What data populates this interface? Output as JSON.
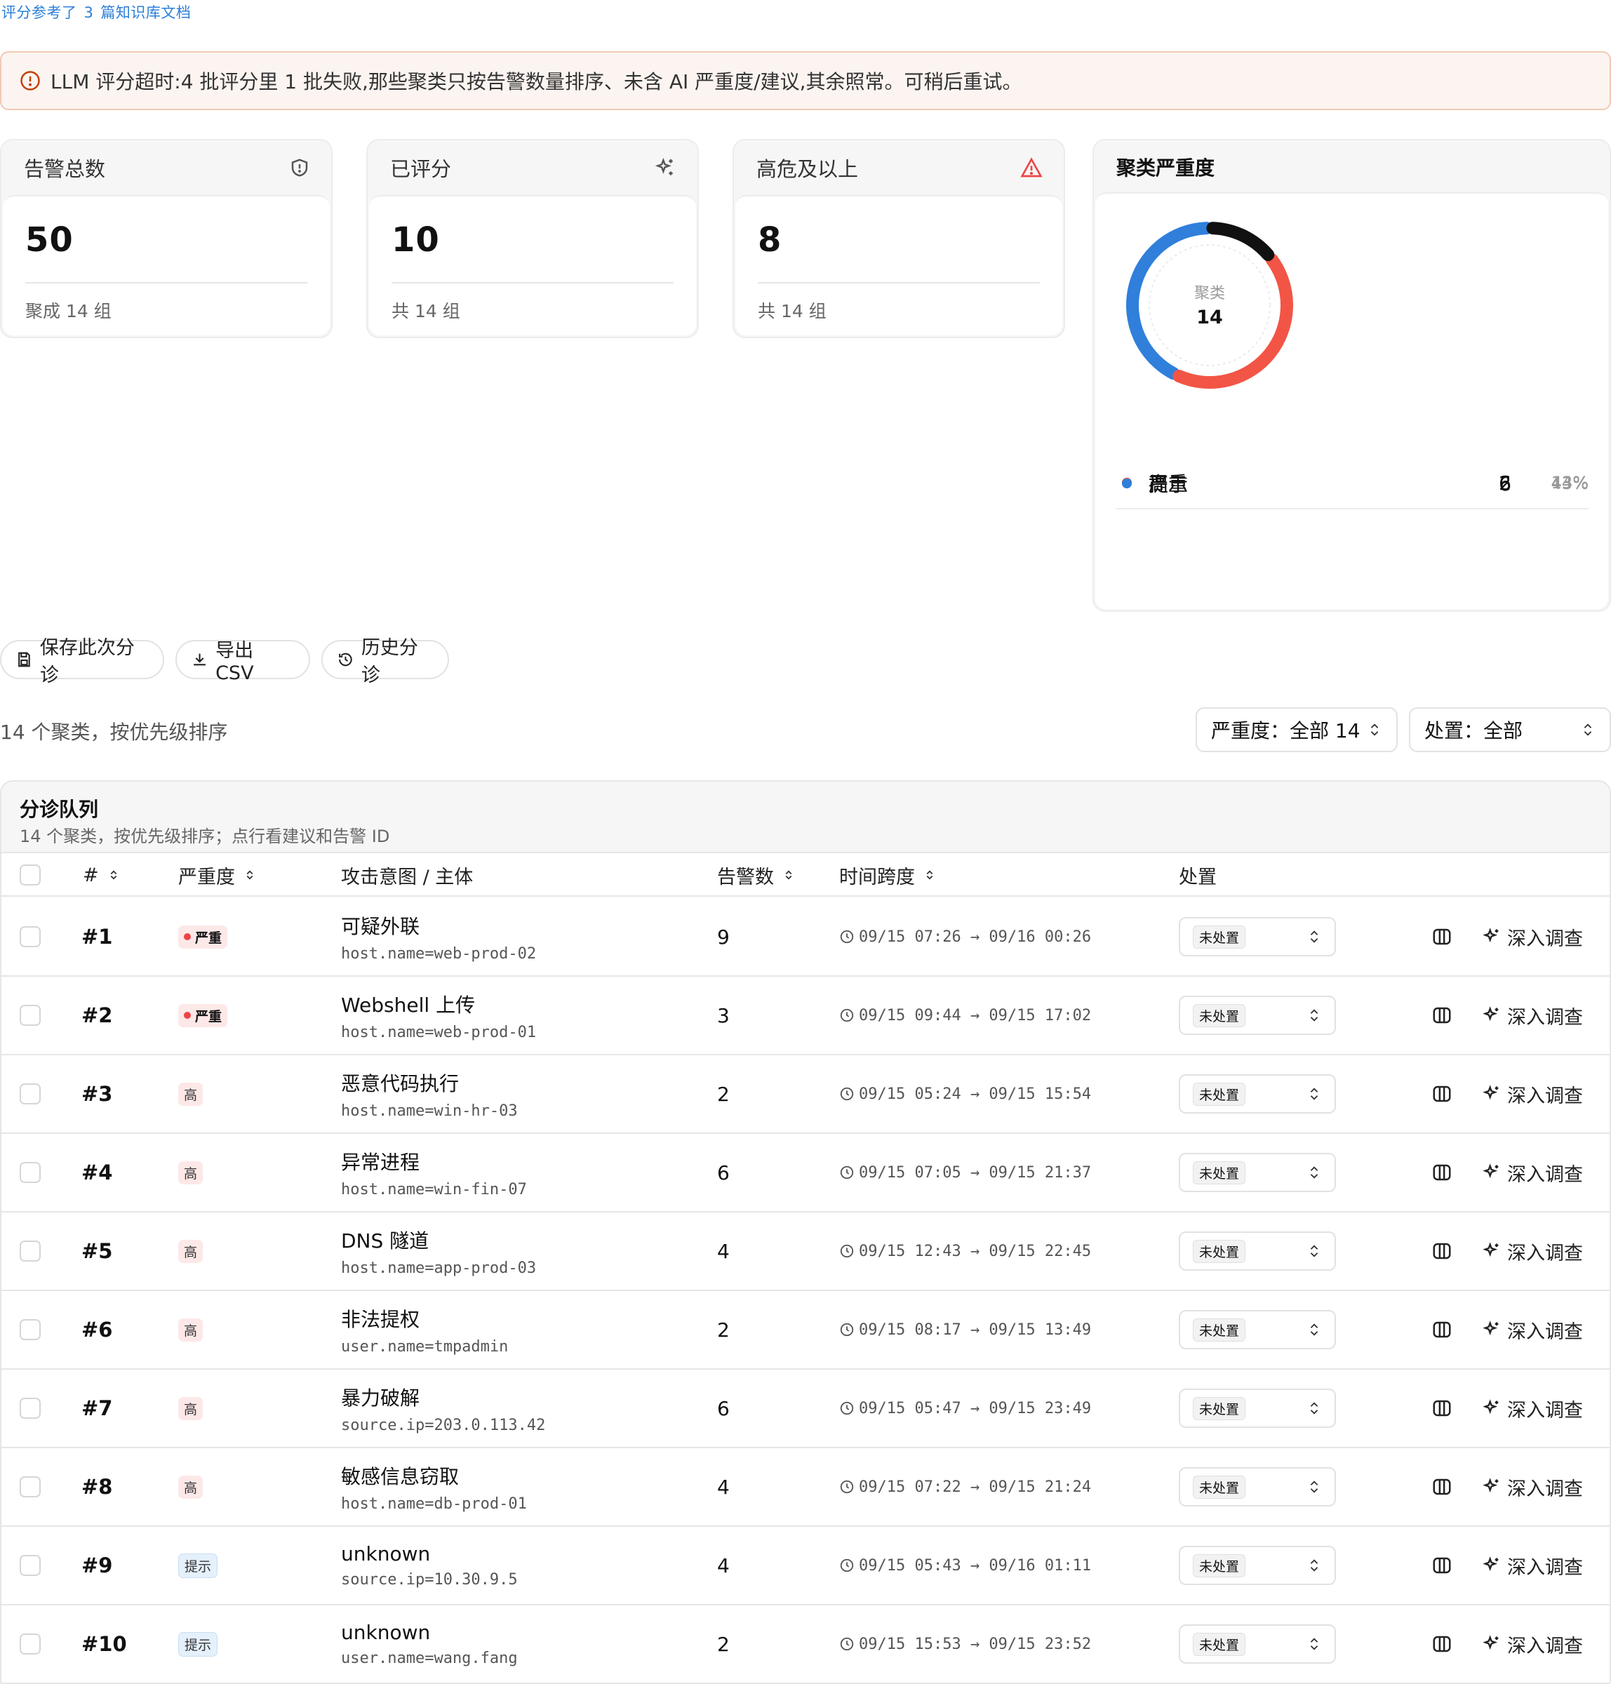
{
  "reference": {
    "prefix": "评分参考了",
    "count": "3",
    "suffix": "篇知识库文档"
  },
  "alert": {
    "text": "LLM 评分超时:4 批评分里 1 批失败,那些聚类只按告警数量排序、未含 AI 严重度/建议,其余照常。可稍后重试。"
  },
  "stats": [
    {
      "label": "告警总数",
      "value": "50",
      "sub": "聚成 14 组",
      "icon": "shield-icon"
    },
    {
      "label": "已评分",
      "value": "10",
      "sub": "共 14 组",
      "icon": "sparkles-icon"
    },
    {
      "label": "高危及以上",
      "value": "8",
      "sub": "共 14 组",
      "icon": "warning-icon"
    }
  ],
  "severity_card": {
    "title": "聚类严重度",
    "center_label": "聚类",
    "center_value": "14",
    "legend": [
      {
        "name": "严重",
        "count": "2",
        "pct": "14%",
        "color": "#111111"
      },
      {
        "name": "高",
        "count": "6",
        "pct": "43%",
        "color": "#f25545"
      },
      {
        "name": "提示",
        "count": "6",
        "pct": "43%",
        "color": "#2f7fdb"
      }
    ]
  },
  "chart_data": {
    "type": "pie",
    "categories": [
      "严重",
      "高",
      "提示"
    ],
    "values": [
      2,
      6,
      6
    ],
    "title": "聚类严重度",
    "center_text": "聚类 14"
  },
  "actions": {
    "save": "保存此次分诊",
    "export": "导出 CSV",
    "history": "历史分诊"
  },
  "summary": "14 个聚类，按优先级排序",
  "filters": {
    "severity": "严重度：全部 14",
    "disposition": "处置：全部"
  },
  "queue": {
    "title": "分诊队列",
    "subtitle": "14 个聚类，按优先级排序；点行看建议和告警 ID",
    "columns": {
      "rank": "#",
      "severity": "严重度",
      "intent": "攻击意图 / 主体",
      "count": "告警数",
      "span": "时间跨度",
      "disposition": "处置"
    },
    "investigate_label": "深入调查",
    "rows": [
      {
        "rank": "#1",
        "severity": "严重",
        "sev_type": "critical",
        "intent": "可疑外联",
        "entity": "host.name=web-prod-02",
        "count": "9",
        "span": "09/15 07:26 → 09/16 00:26",
        "disposition": "未处置"
      },
      {
        "rank": "#2",
        "severity": "严重",
        "sev_type": "critical",
        "intent": "Webshell 上传",
        "entity": "host.name=web-prod-01",
        "count": "3",
        "span": "09/15 09:44 → 09/15 17:02",
        "disposition": "未处置"
      },
      {
        "rank": "#3",
        "severity": "高",
        "sev_type": "high",
        "intent": "恶意代码执行",
        "entity": "host.name=win-hr-03",
        "count": "2",
        "span": "09/15 05:24 → 09/15 15:54",
        "disposition": "未处置"
      },
      {
        "rank": "#4",
        "severity": "高",
        "sev_type": "high",
        "intent": "异常进程",
        "entity": "host.name=win-fin-07",
        "count": "6",
        "span": "09/15 07:05 → 09/15 21:37",
        "disposition": "未处置"
      },
      {
        "rank": "#5",
        "severity": "高",
        "sev_type": "high",
        "intent": "DNS 隧道",
        "entity": "host.name=app-prod-03",
        "count": "4",
        "span": "09/15 12:43 → 09/15 22:45",
        "disposition": "未处置"
      },
      {
        "rank": "#6",
        "severity": "高",
        "sev_type": "high",
        "intent": "非法提权",
        "entity": "user.name=tmpadmin",
        "count": "2",
        "span": "09/15 08:17 → 09/15 13:49",
        "disposition": "未处置"
      },
      {
        "rank": "#7",
        "severity": "高",
        "sev_type": "high",
        "intent": "暴力破解",
        "entity": "source.ip=203.0.113.42",
        "count": "6",
        "span": "09/15 05:47 → 09/15 23:49",
        "disposition": "未处置"
      },
      {
        "rank": "#8",
        "severity": "高",
        "sev_type": "high",
        "intent": "敏感信息窃取",
        "entity": "host.name=db-prod-01",
        "count": "4",
        "span": "09/15 07:22 → 09/15 21:24",
        "disposition": "未处置"
      },
      {
        "rank": "#9",
        "severity": "提示",
        "sev_type": "info",
        "intent": "unknown",
        "entity": "source.ip=10.30.9.5",
        "count": "4",
        "span": "09/15 05:43 → 09/16 01:11",
        "disposition": "未处置"
      },
      {
        "rank": "#10",
        "severity": "提示",
        "sev_type": "info",
        "intent": "unknown",
        "entity": "user.name=wang.fang",
        "count": "2",
        "span": "09/15 15:53 → 09/15 23:52",
        "disposition": "未处置"
      }
    ]
  }
}
